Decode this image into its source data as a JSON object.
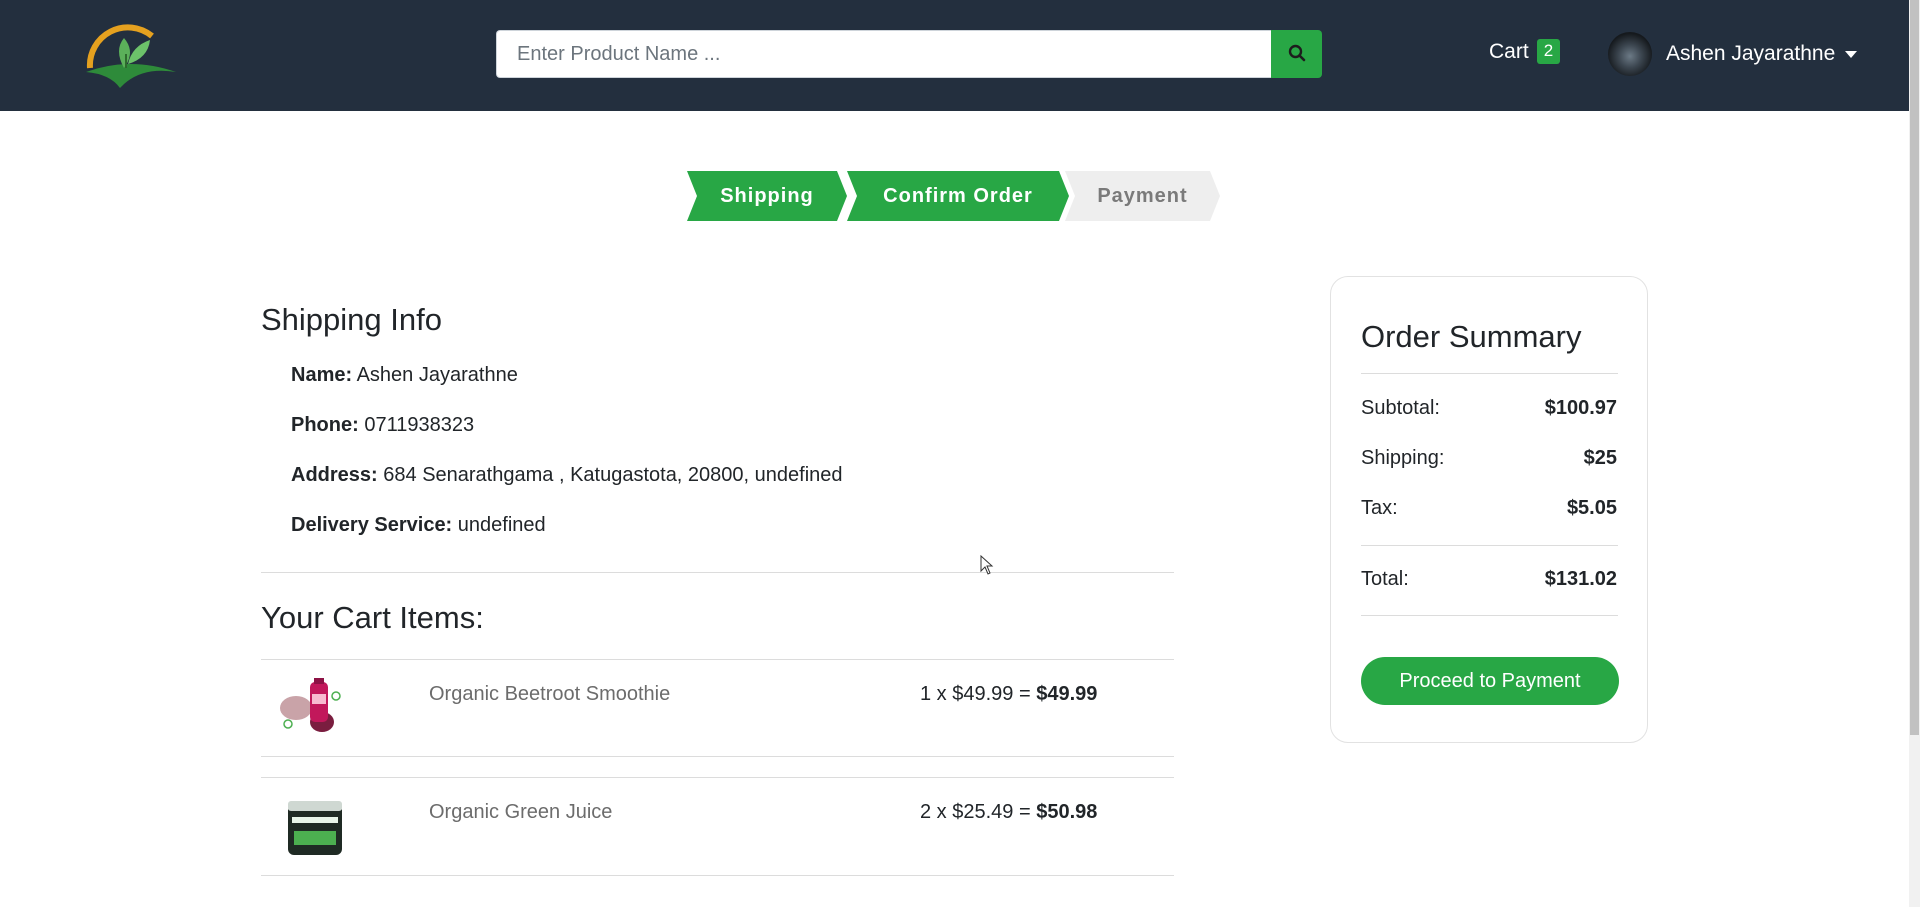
{
  "header": {
    "logo_icon": "leaf-logo-icon",
    "search": {
      "placeholder": "Enter Product Name ...",
      "value": "",
      "icon": "search-icon"
    },
    "cart": {
      "label": "Cart",
      "count": "2"
    },
    "user": {
      "name": "Ashen Jayarathne",
      "icon": "chevron-down-icon"
    }
  },
  "steps": [
    {
      "label": "Shipping",
      "state": "done"
    },
    {
      "label": "Confirm Order",
      "state": "done"
    },
    {
      "label": "Payment",
      "state": "pending"
    }
  ],
  "shipping": {
    "title": "Shipping Info",
    "name_label": "Name:",
    "name": "Ashen Jayarathne",
    "phone_label": "Phone:",
    "phone": "0711938323",
    "address_label": "Address:",
    "address": "684 Senarathgama , Katugastota, 20800, undefined",
    "delivery_label": "Delivery Service:",
    "delivery": "undefined"
  },
  "cart": {
    "title": "Your Cart Items:",
    "items": [
      {
        "name": "Organic Beetroot Smoothie",
        "calc": "1 x $49.99 = ",
        "total": "$49.99"
      },
      {
        "name": "Organic Green Juice",
        "calc": "2 x $25.49 = ",
        "total": "$50.98"
      }
    ]
  },
  "summary": {
    "title": "Order Summary",
    "subtotal_label": "Subtotal:",
    "subtotal": "$100.97",
    "shipping_label": "Shipping:",
    "shipping": "$25",
    "tax_label": "Tax:",
    "tax": "$5.05",
    "total_label": "Total:",
    "total": "$131.02",
    "button": "Proceed to Payment"
  },
  "colors": {
    "nav": "#232f3e",
    "accent": "#28a745",
    "step_pending": "#eeeeee"
  }
}
